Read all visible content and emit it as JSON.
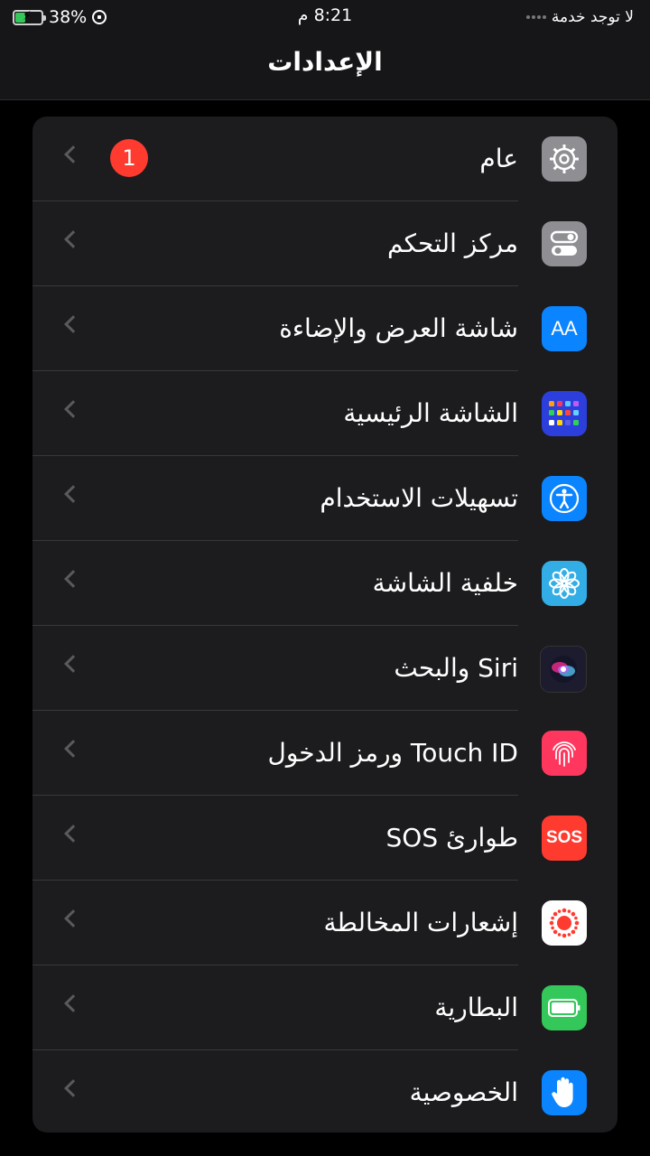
{
  "status": {
    "battery": "38%",
    "battery_level": 0.38,
    "time": "8:21 م",
    "carrier": "لا توجد خدمة"
  },
  "title": "الإعدادات",
  "colors": {
    "background": "#000000",
    "group": "#1c1c1e",
    "badge": "#ff3b30"
  },
  "rows": [
    {
      "label": "عام",
      "icon": "gear-icon",
      "color": "#8e8e93",
      "badge": "1"
    },
    {
      "label": "مركز التحكم",
      "icon": "toggles-icon",
      "color": "#8e8e93"
    },
    {
      "label": "شاشة العرض والإضاءة",
      "icon": "text-size-icon",
      "color": "#0a84ff",
      "icon_text": "AA"
    },
    {
      "label": "الشاشة الرئيسية",
      "icon": "home-screen-grid-icon",
      "color": "#2c3fdc"
    },
    {
      "label": "تسهيلات الاستخدام",
      "icon": "accessibility-icon",
      "color": "#0a84ff"
    },
    {
      "label": "خلفية الشاشة",
      "icon": "wallpaper-flower-icon",
      "color": "#32ade6"
    },
    {
      "label": "Siri والبحث",
      "icon": "siri-icon",
      "color": "#1c1c2e"
    },
    {
      "label": "Touch ID ورمز الدخول",
      "icon": "fingerprint-icon",
      "color": "#ff375f"
    },
    {
      "label": "طوارئ SOS",
      "icon": "sos-icon",
      "color": "#ff3b30",
      "icon_text": "SOS"
    },
    {
      "label": "إشعارات المخالطة",
      "icon": "exposure-notification-icon",
      "color": "#ffffff"
    },
    {
      "label": "البطارية",
      "icon": "battery-icon",
      "color": "#34c759"
    },
    {
      "label": "الخصوصية",
      "icon": "hand-icon",
      "color": "#0a84ff"
    }
  ]
}
